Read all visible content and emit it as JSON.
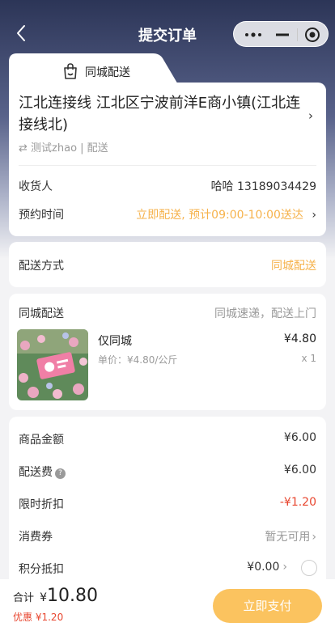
{
  "nav": {
    "title": "提交订单"
  },
  "tab": {
    "label": "同城配送"
  },
  "address": {
    "text": "江北连接线 江北区宁波前洋E商小镇(江北连接线北)",
    "sub": "测试zhao | 配送",
    "sub_icon": "⇄",
    "receiver_label": "收货人",
    "receiver_value": "哈哈 13189034429",
    "time_label": "预约时间",
    "time_value": "立即配送, 预计09:00-10:00送达"
  },
  "method": {
    "label": "配送方式",
    "value": "同城配送"
  },
  "goods": {
    "header_label": "同城配送",
    "header_right": "同城速递，配送上门",
    "item_name": "仅同城",
    "unit_price": "单价：¥4.80/公斤",
    "price": "¥4.80",
    "qty": "x 1"
  },
  "summary": {
    "goods_amount_label": "商品金额",
    "goods_amount_value": "¥6.00",
    "delivery_label": "配送费",
    "delivery_value": "¥6.00",
    "discount_label": "限时折扣",
    "discount_value": "-¥1.20",
    "coupon_label": "消费券",
    "coupon_value": "暂无可用",
    "points_label": "积分抵扣",
    "points_value": "¥0.00"
  },
  "footer": {
    "total_label": "合计",
    "total_currency": "¥",
    "total_value": "10.80",
    "saving_label": "优惠",
    "saving_value": "¥1.20",
    "pay_label": "立即支付"
  },
  "colors": {
    "accent": "#f6b24b",
    "discount": "#e8462f",
    "pay_button": "#fbc35f"
  }
}
